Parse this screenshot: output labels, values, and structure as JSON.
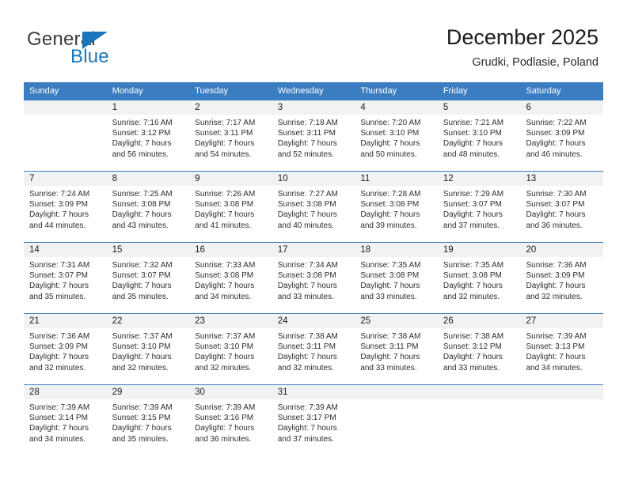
{
  "brand": {
    "name_top": "General",
    "name_bottom": "Blue",
    "accent_color": "#1a75bb"
  },
  "header": {
    "title": "December 2025",
    "subtitle": "Grudki, Podlasie, Poland"
  },
  "theme": {
    "header_row_bg": "#3b7dc1",
    "daynum_band_bg": "#f2f2f2",
    "page_bg": "#ffffff",
    "text_color": "#2e2e2e"
  },
  "weekdays": [
    "Sunday",
    "Monday",
    "Tuesday",
    "Wednesday",
    "Thursday",
    "Friday",
    "Saturday"
  ],
  "weeks": [
    [
      {
        "day": "",
        "sunrise": "",
        "sunset": "",
        "daylight1": "",
        "daylight2": ""
      },
      {
        "day": "1",
        "sunrise": "Sunrise: 7:16 AM",
        "sunset": "Sunset: 3:12 PM",
        "daylight1": "Daylight: 7 hours",
        "daylight2": "and 56 minutes."
      },
      {
        "day": "2",
        "sunrise": "Sunrise: 7:17 AM",
        "sunset": "Sunset: 3:11 PM",
        "daylight1": "Daylight: 7 hours",
        "daylight2": "and 54 minutes."
      },
      {
        "day": "3",
        "sunrise": "Sunrise: 7:18 AM",
        "sunset": "Sunset: 3:11 PM",
        "daylight1": "Daylight: 7 hours",
        "daylight2": "and 52 minutes."
      },
      {
        "day": "4",
        "sunrise": "Sunrise: 7:20 AM",
        "sunset": "Sunset: 3:10 PM",
        "daylight1": "Daylight: 7 hours",
        "daylight2": "and 50 minutes."
      },
      {
        "day": "5",
        "sunrise": "Sunrise: 7:21 AM",
        "sunset": "Sunset: 3:10 PM",
        "daylight1": "Daylight: 7 hours",
        "daylight2": "and 48 minutes."
      },
      {
        "day": "6",
        "sunrise": "Sunrise: 7:22 AM",
        "sunset": "Sunset: 3:09 PM",
        "daylight1": "Daylight: 7 hours",
        "daylight2": "and 46 minutes."
      }
    ],
    [
      {
        "day": "7",
        "sunrise": "Sunrise: 7:24 AM",
        "sunset": "Sunset: 3:09 PM",
        "daylight1": "Daylight: 7 hours",
        "daylight2": "and 44 minutes."
      },
      {
        "day": "8",
        "sunrise": "Sunrise: 7:25 AM",
        "sunset": "Sunset: 3:08 PM",
        "daylight1": "Daylight: 7 hours",
        "daylight2": "and 43 minutes."
      },
      {
        "day": "9",
        "sunrise": "Sunrise: 7:26 AM",
        "sunset": "Sunset: 3:08 PM",
        "daylight1": "Daylight: 7 hours",
        "daylight2": "and 41 minutes."
      },
      {
        "day": "10",
        "sunrise": "Sunrise: 7:27 AM",
        "sunset": "Sunset: 3:08 PM",
        "daylight1": "Daylight: 7 hours",
        "daylight2": "and 40 minutes."
      },
      {
        "day": "11",
        "sunrise": "Sunrise: 7:28 AM",
        "sunset": "Sunset: 3:08 PM",
        "daylight1": "Daylight: 7 hours",
        "daylight2": "and 39 minutes."
      },
      {
        "day": "12",
        "sunrise": "Sunrise: 7:29 AM",
        "sunset": "Sunset: 3:07 PM",
        "daylight1": "Daylight: 7 hours",
        "daylight2": "and 37 minutes."
      },
      {
        "day": "13",
        "sunrise": "Sunrise: 7:30 AM",
        "sunset": "Sunset: 3:07 PM",
        "daylight1": "Daylight: 7 hours",
        "daylight2": "and 36 minutes."
      }
    ],
    [
      {
        "day": "14",
        "sunrise": "Sunrise: 7:31 AM",
        "sunset": "Sunset: 3:07 PM",
        "daylight1": "Daylight: 7 hours",
        "daylight2": "and 35 minutes."
      },
      {
        "day": "15",
        "sunrise": "Sunrise: 7:32 AM",
        "sunset": "Sunset: 3:07 PM",
        "daylight1": "Daylight: 7 hours",
        "daylight2": "and 35 minutes."
      },
      {
        "day": "16",
        "sunrise": "Sunrise: 7:33 AM",
        "sunset": "Sunset: 3:08 PM",
        "daylight1": "Daylight: 7 hours",
        "daylight2": "and 34 minutes."
      },
      {
        "day": "17",
        "sunrise": "Sunrise: 7:34 AM",
        "sunset": "Sunset: 3:08 PM",
        "daylight1": "Daylight: 7 hours",
        "daylight2": "and 33 minutes."
      },
      {
        "day": "18",
        "sunrise": "Sunrise: 7:35 AM",
        "sunset": "Sunset: 3:08 PM",
        "daylight1": "Daylight: 7 hours",
        "daylight2": "and 33 minutes."
      },
      {
        "day": "19",
        "sunrise": "Sunrise: 7:35 AM",
        "sunset": "Sunset: 3:08 PM",
        "daylight1": "Daylight: 7 hours",
        "daylight2": "and 32 minutes."
      },
      {
        "day": "20",
        "sunrise": "Sunrise: 7:36 AM",
        "sunset": "Sunset: 3:09 PM",
        "daylight1": "Daylight: 7 hours",
        "daylight2": "and 32 minutes."
      }
    ],
    [
      {
        "day": "21",
        "sunrise": "Sunrise: 7:36 AM",
        "sunset": "Sunset: 3:09 PM",
        "daylight1": "Daylight: 7 hours",
        "daylight2": "and 32 minutes."
      },
      {
        "day": "22",
        "sunrise": "Sunrise: 7:37 AM",
        "sunset": "Sunset: 3:10 PM",
        "daylight1": "Daylight: 7 hours",
        "daylight2": "and 32 minutes."
      },
      {
        "day": "23",
        "sunrise": "Sunrise: 7:37 AM",
        "sunset": "Sunset: 3:10 PM",
        "daylight1": "Daylight: 7 hours",
        "daylight2": "and 32 minutes."
      },
      {
        "day": "24",
        "sunrise": "Sunrise: 7:38 AM",
        "sunset": "Sunset: 3:11 PM",
        "daylight1": "Daylight: 7 hours",
        "daylight2": "and 32 minutes."
      },
      {
        "day": "25",
        "sunrise": "Sunrise: 7:38 AM",
        "sunset": "Sunset: 3:11 PM",
        "daylight1": "Daylight: 7 hours",
        "daylight2": "and 33 minutes."
      },
      {
        "day": "26",
        "sunrise": "Sunrise: 7:38 AM",
        "sunset": "Sunset: 3:12 PM",
        "daylight1": "Daylight: 7 hours",
        "daylight2": "and 33 minutes."
      },
      {
        "day": "27",
        "sunrise": "Sunrise: 7:39 AM",
        "sunset": "Sunset: 3:13 PM",
        "daylight1": "Daylight: 7 hours",
        "daylight2": "and 34 minutes."
      }
    ],
    [
      {
        "day": "28",
        "sunrise": "Sunrise: 7:39 AM",
        "sunset": "Sunset: 3:14 PM",
        "daylight1": "Daylight: 7 hours",
        "daylight2": "and 34 minutes."
      },
      {
        "day": "29",
        "sunrise": "Sunrise: 7:39 AM",
        "sunset": "Sunset: 3:15 PM",
        "daylight1": "Daylight: 7 hours",
        "daylight2": "and 35 minutes."
      },
      {
        "day": "30",
        "sunrise": "Sunrise: 7:39 AM",
        "sunset": "Sunset: 3:16 PM",
        "daylight1": "Daylight: 7 hours",
        "daylight2": "and 36 minutes."
      },
      {
        "day": "31",
        "sunrise": "Sunrise: 7:39 AM",
        "sunset": "Sunset: 3:17 PM",
        "daylight1": "Daylight: 7 hours",
        "daylight2": "and 37 minutes."
      },
      {
        "day": "",
        "sunrise": "",
        "sunset": "",
        "daylight1": "",
        "daylight2": ""
      },
      {
        "day": "",
        "sunrise": "",
        "sunset": "",
        "daylight1": "",
        "daylight2": ""
      },
      {
        "day": "",
        "sunrise": "",
        "sunset": "",
        "daylight1": "",
        "daylight2": ""
      }
    ]
  ]
}
